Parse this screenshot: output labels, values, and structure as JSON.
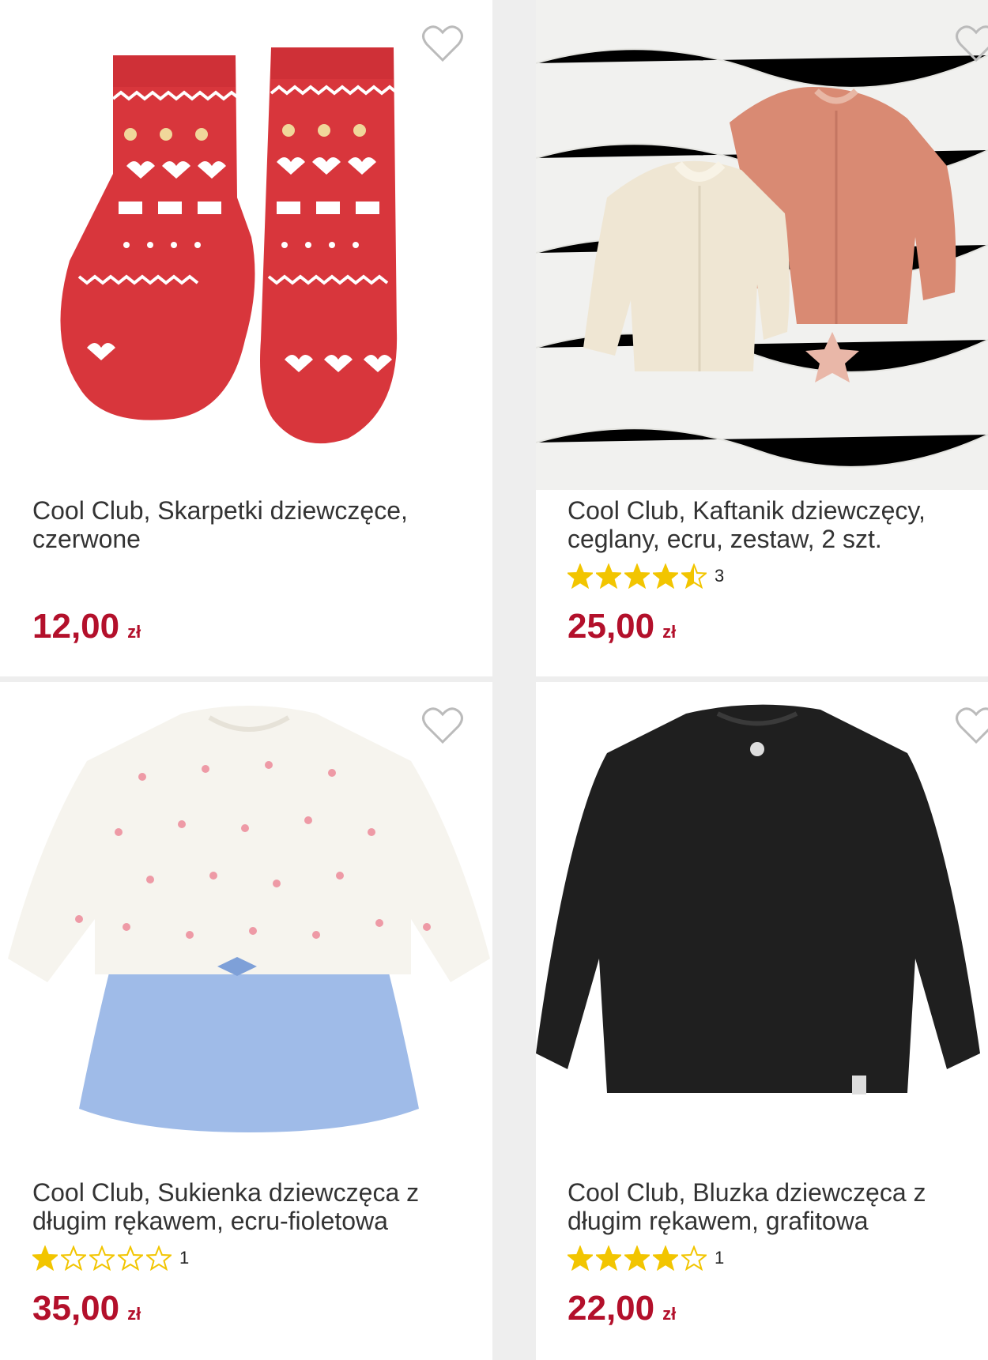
{
  "colors": {
    "price": "#b3102b",
    "star": "#f2c500",
    "title": "#333333"
  },
  "products": [
    {
      "title": "Cool Club, Skarpetki dziewczęce, czerwone",
      "price": "12,00",
      "currency": "zł",
      "rating": 0,
      "rating_count": "",
      "image": "red-christmas-socks",
      "favorite_icon": "heart-outline-icon"
    },
    {
      "title": "Cool Club, Kaftanik dziewczęcy, ceglany, ecru, zestaw, 2 szt.",
      "price": "25,00",
      "currency": "zł",
      "rating": 4.5,
      "rating_count": "3",
      "image": "two-cardigans-ecru-and-brick",
      "favorite_icon": "heart-outline-icon"
    },
    {
      "title": "Cool Club, Sukienka dziewczęca z długim rękawem, ecru-fioletowa",
      "price": "35,00",
      "currency": "zł",
      "rating": 1,
      "rating_count": "1",
      "image": "ecru-blue-dress",
      "favorite_icon": "heart-outline-icon"
    },
    {
      "title": "Cool Club, Bluzka dziewczęca z długim rękawem, grafitowa",
      "price": "22,00",
      "currency": "zł",
      "rating": 4,
      "rating_count": "1",
      "image": "graphite-long-sleeve-top",
      "favorite_icon": "heart-outline-icon"
    }
  ]
}
